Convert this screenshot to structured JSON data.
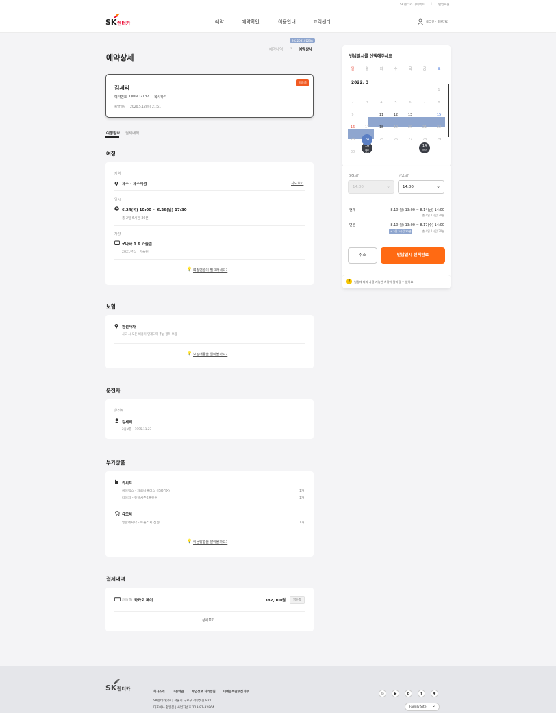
{
  "topbar": {
    "rentacar_direct": "SK렌터카 다이렉트",
    "corporate": "법인회원"
  },
  "header": {
    "logo_sk": "SK",
    "logo_rentacar": "렌터카",
    "nav": [
      "예약",
      "예약확인",
      "이용안내",
      "고객센터"
    ],
    "auth": "로그인 · 회원가입"
  },
  "breadcrumb": {
    "badge": "20220810123A",
    "prev": "예약내역",
    "current": "예약상세"
  },
  "page_title": "예약상세",
  "summary": {
    "name": "김세리",
    "status": "이용중",
    "reservation_no_label": "예약번호",
    "reservation_no": "QMND2132",
    "copy": "복사하기",
    "issued_label": "출발일시",
    "issued": "2020.5.12(목) 21:51"
  },
  "tabs": [
    "여정정보",
    "결제내역"
  ],
  "trip": {
    "title": "여정",
    "region_label": "지역",
    "region": "제주 · 제주지점",
    "map_link": "지도보기",
    "datetime_label": "일시",
    "datetime": "6.24(목) 10:00 ~ 6.26(일) 17:30",
    "duration": "총 2일 6시간 30분",
    "vehicle_label": "차량",
    "vehicle": "쏘나타 1.6 가솔린",
    "vehicle_sub": "2021년식 · 가솔린",
    "change_link": "여정변경이 필요하세요?"
  },
  "insurance": {
    "title": "보험",
    "name": "완전자차",
    "desc": "사고 시 모든 비용이 면제되며 추납 항목 보장",
    "link": "보장내용을 알아볼까요?"
  },
  "driver": {
    "title": "운전자",
    "label": "운전자",
    "name": "김세리",
    "license": "2종보통 · 1995.11.27"
  },
  "addons": {
    "title": "부가상품",
    "group1": "카시트",
    "items1": [
      {
        "name": "싸이벡스 - 제로나플러스 (ISOFIX)",
        "qty": "1개"
      },
      {
        "name": "다이치 - 듀엘시즌2플린원",
        "qty": "1개"
      }
    ],
    "group2": "유모차",
    "items2": [
      {
        "name": "잉글레시나 - 트롤리지 신형",
        "qty": "1개"
      }
    ],
    "link": "이용방법을 알아볼까요?"
  },
  "payment": {
    "title": "결제내역",
    "method_prefix": "카드(결)",
    "method": "카카오 페이",
    "amount": "382,000원",
    "badge": "영수증",
    "detail": "상세보기"
  },
  "calendar": {
    "title": "반납일시를 선택해주세요",
    "weekdays": [
      "일",
      "월",
      "화",
      "수",
      "목",
      "금",
      "토"
    ],
    "month": "2022. 3",
    "days": [
      "1",
      "2",
      "3",
      "4",
      "5",
      "6",
      "7",
      "8",
      "9",
      "10",
      "11",
      "12",
      "13",
      "14",
      "15",
      "16",
      "17",
      "18",
      "19",
      "20",
      "21",
      "22",
      "23",
      "24",
      "25",
      "26",
      "27",
      "28",
      "29",
      "30",
      "31"
    ],
    "start_tag": "대여",
    "end_tag": "반납",
    "rent_time_label": "대여시간",
    "rent_time": "14:00",
    "return_time_label": "반납시간",
    "return_time": "14:00",
    "current_label": "현재",
    "current": "8.10(월) 13:00 ~ 8.14(금) 14:00",
    "current_sub": "총 4일 1시간 30분",
    "change_label": "변경",
    "change": "8.10(월) 13:00 ~ 8.17(수) 14:00",
    "change_badge": "+ 2일 2시간 30분",
    "change_sub": "총 4일 1시간 30분",
    "cancel": "취소",
    "confirm": "반납일시 선택완료",
    "notice": "일정에 따라 사용 가능한 차량이 달라질 수 있어요"
  },
  "footer": {
    "logo_sk": "SK",
    "logo_rentacar": "렌터카",
    "links": [
      "회사소개",
      "이용약관",
      "개인정보 처리방침",
      "이메일무단수집거부"
    ],
    "line1": "SK렌터카(주)  |  서울시 구로구 서부샛길 822",
    "line2": "대표이사  황일문  |  사업자번호  113-81-32864",
    "family_site": "Family Site",
    "sns": [
      "instagram-icon",
      "youtube-icon",
      "blog-icon",
      "facebook-icon",
      "kakao-icon"
    ]
  },
  "colors": {
    "accent": "#ff6a13",
    "brand_red": "#ea002c",
    "range": "#8fa6cf",
    "dark": "#3a3d45"
  }
}
